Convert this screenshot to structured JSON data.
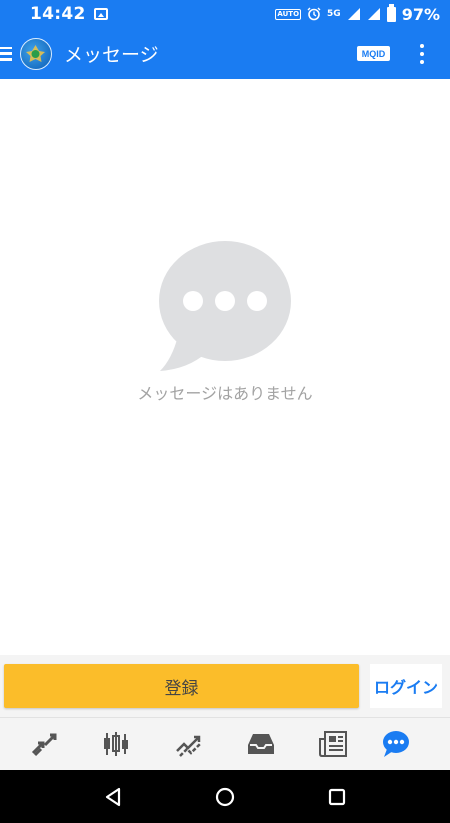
{
  "status_bar": {
    "time": "14:42",
    "auto_label": "AUTO",
    "network_label": "5G",
    "battery_percent": "97%"
  },
  "app_bar": {
    "title": "メッセージ",
    "mqid_label": "MQID"
  },
  "empty_state": {
    "message": "メッセージはありません"
  },
  "actions": {
    "register_label": "登録",
    "login_label": "ログイン"
  },
  "bottom_nav": {
    "items": [
      {
        "icon": "quotes-icon",
        "active": false
      },
      {
        "icon": "chart-candles-icon",
        "active": false
      },
      {
        "icon": "trade-icon",
        "active": false
      },
      {
        "icon": "history-inbox-icon",
        "active": false
      },
      {
        "icon": "news-icon",
        "active": false
      },
      {
        "icon": "messages-icon",
        "active": true
      }
    ]
  },
  "colors": {
    "primary": "#1a7cf2",
    "accent_button": "#fbbd2a",
    "icon_inactive": "#555555",
    "empty_text": "#a3a3a3"
  }
}
